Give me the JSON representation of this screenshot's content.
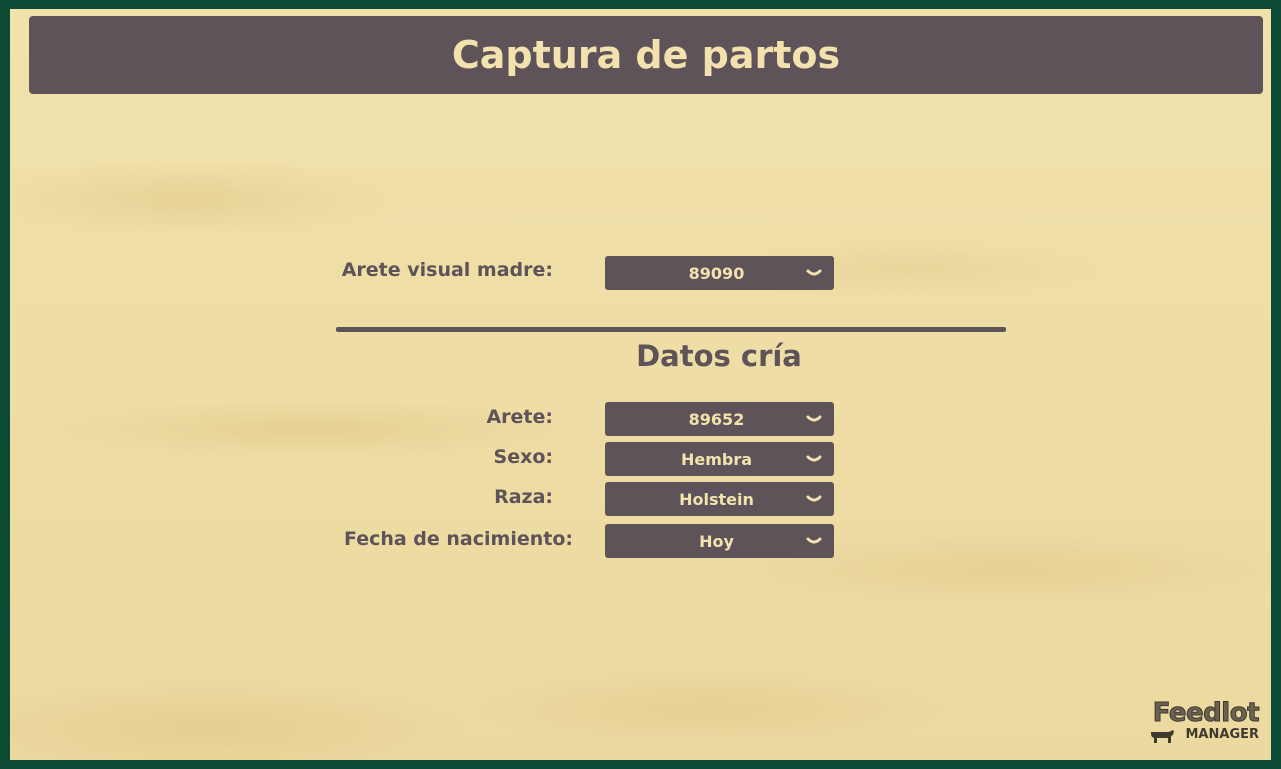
{
  "header": {
    "title": "Captura de partos"
  },
  "mother": {
    "label": "Arete visual madre:",
    "value": "89090"
  },
  "calf_section": {
    "title": "Datos cría",
    "fields": [
      {
        "label": "Arete:",
        "value": "89652"
      },
      {
        "label": "Sexo:",
        "value": "Hembra"
      },
      {
        "label": "Raza:",
        "value": "Holstein"
      },
      {
        "label": "Fecha de nacimiento:",
        "value": "Hoy"
      }
    ]
  },
  "logo": {
    "brand": "Feedlot",
    "sub": "MANAGER",
    "icon": "cow-icon"
  },
  "colors": {
    "frame": "#0c4a33",
    "background": "#eedda4",
    "panel": "#5d5359",
    "panel_text": "#f3e2ad"
  }
}
